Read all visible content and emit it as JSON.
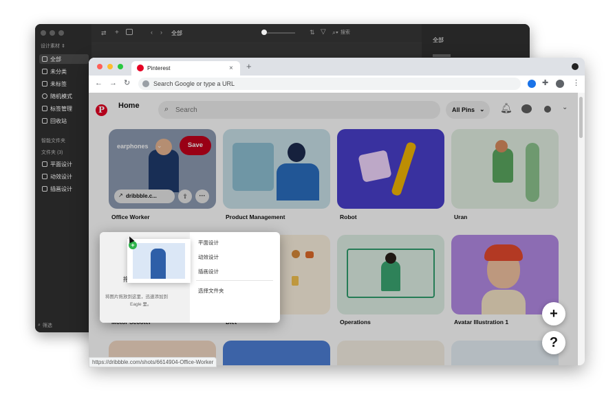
{
  "eagle": {
    "toolbar_title": "全部",
    "search_placeholder": "搜索",
    "library_label": "设计素材 ⇕",
    "items": [
      "全部",
      "未分类",
      "未标签",
      "随机模式",
      "标签管理",
      "回收站"
    ],
    "smart_folder_label": "智能文件夹",
    "folders_label": "文件夹 (3)",
    "folders": [
      "平面设计",
      "动效设计",
      "插画设计"
    ],
    "filter_placeholder": "筛选",
    "inspector_title": "全部"
  },
  "browser": {
    "tab_title": "Pinterest",
    "address_placeholder": "Search Google or type a URL",
    "status_url": "https://dribbble.com/shots/6614904-Office-Worker"
  },
  "pinterest": {
    "logo_glyph": "P",
    "home_label": "Home",
    "search_placeholder": "Search",
    "filter_label": "All Pins",
    "hover_pin": {
      "board": "earphones",
      "save_label": "Save",
      "link_label": "dribbble.c..."
    },
    "pins_row1": [
      "Office Worker",
      "Product Management",
      "Robot",
      "Uran"
    ],
    "pins_row2": [
      "Motor Scooter",
      "Diet",
      "Operations",
      "Avatar Illustration 1"
    ],
    "fab_plus": "+",
    "fab_help": "?"
  },
  "popup": {
    "hint_text_1": "拖",
    "hint_text_2": "将图片拖放到这里，迅速添加到",
    "hint_text_3": "Eagle 里。",
    "folders": [
      "平面设计",
      "动效设计",
      "插画设计"
    ],
    "choose_folder": "选择文件夹"
  },
  "colors": {
    "pinterest_red": "#e60023",
    "eagle_bg": "#2b2b2b",
    "chrome_tabbar": "#dee1e6"
  }
}
